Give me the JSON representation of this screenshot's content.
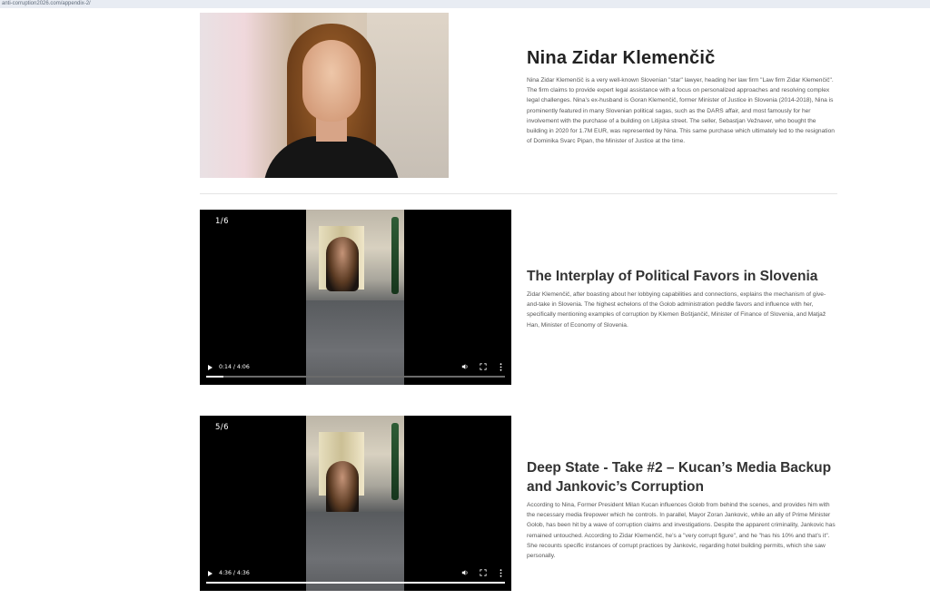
{
  "browser": {
    "url": "anti-corruption2026.com/appendix-2/"
  },
  "profile": {
    "name": "Nina Zidar Klemenčič",
    "bio": "Nina Zidar Klemenčič is a very well-known Slovenian \"star\" lawyer, heading her law firm \"Law firm Zidar Klemenčič\". The firm claims to provide expert legal assistance with a focus on personalized approaches and resolving complex legal challenges. Nina’s ex-husband is Goran Klemenčič, former Minister of Justice in Slovenia (2014-2018), Nina is prominently featured in many Slovenian political sagas, such as the DARS affair, and most famously for her involvement with the purchase of a building on Litijska street. The seller, Sebastjan Vežnaver, who bought the building in 2020 for 1.7M EUR, was represented by Nina. This same purchase which ultimately led to the resignation of Dominika Svarc Pipan, the Minister of Justice at the time."
  },
  "sections": [
    {
      "title": "The Interplay of Political Favors in Slovenia",
      "text": "Zidar Klemenčič, after boasting about her lobbying capabilities and connections, explains the mechanism of give-and-take in Slovenia. The highest echelons of the Golob administration peddle favors and influence with her, specifically mentioning examples of corruption by Klemen Boštjančič, Minister of Finance of Slovenia, and Matjaž Han, Minister of Economy of Slovenia.",
      "video": {
        "counter": "1/6",
        "time": "0:14 / 4:06",
        "progress": 0.057
      }
    },
    {
      "title": "Deep State - Take #2 – Kucan’s Media Backup and Jankovic’s Corruption",
      "text": "According to Nina, Former President Milan Kucan influences Golob from behind the scenes, and provides him with the necessary media firepower which he controls. In parallel, Mayor Zoran Jankovic, while an ally of Prime Minister Golob, has been hit by a wave of corruption claims and investigations. Despite the apparent criminality, Jankovic has remained untouched. According to Zidar Klemenčič, he’s a \"very corrupt figure\", and he \"has his 10% and that’s it\". She recounts specific instances of corrupt practices by Jankovic, regarding hotel building permits, which she saw personally.",
      "video": {
        "counter": "5/6",
        "time": "4:36 / 4:36",
        "progress": 1.0
      }
    }
  ],
  "icons": {
    "play": "play-icon",
    "volume": "volume-icon",
    "fullscreen": "fullscreen-icon",
    "more": "more-options-icon"
  },
  "colors": {
    "page_bg": "#ffffff",
    "heading": "#222222",
    "video_bg": "#000000"
  }
}
